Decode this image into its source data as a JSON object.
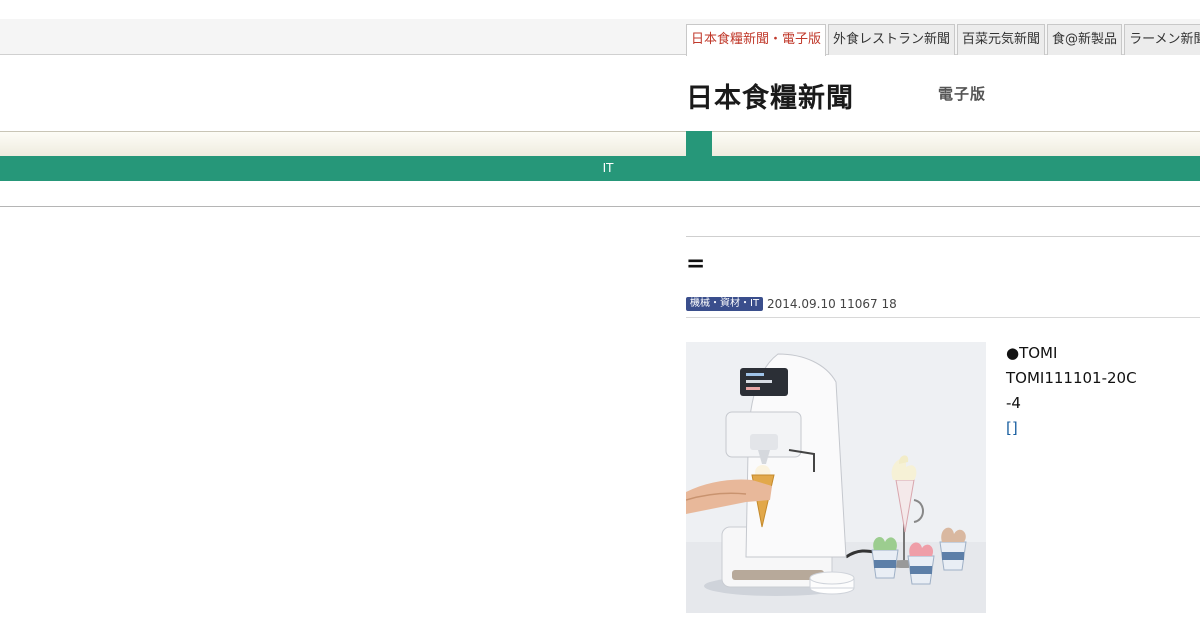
{
  "header": {
    "tabs": [
      {
        "label": "日本食糧新聞・電子版",
        "active": true
      },
      {
        "label": "外食レストラン新聞",
        "active": false
      },
      {
        "label": "百菜元気新聞",
        "active": false
      },
      {
        "label": "食@新製品",
        "active": false
      },
      {
        "label": "ラーメン新聞",
        "active": false
      }
    ],
    "logo": "日本食糧新聞",
    "logo_sub": "電子版"
  },
  "nav": {
    "label": "IT"
  },
  "article": {
    "title": "=",
    "category": "機械・資材・IT",
    "meta": "2014.09.10 11067 18",
    "body_lines": [
      "●TOMI",
      "TOMI111101-20C",
      "-4"
    ],
    "link": "[]"
  },
  "colors": {
    "brand_green": "#269779",
    "category_badge": "#3a4e8c",
    "active_tab_text": "#c0392b",
    "link": "#1a5fa0"
  }
}
